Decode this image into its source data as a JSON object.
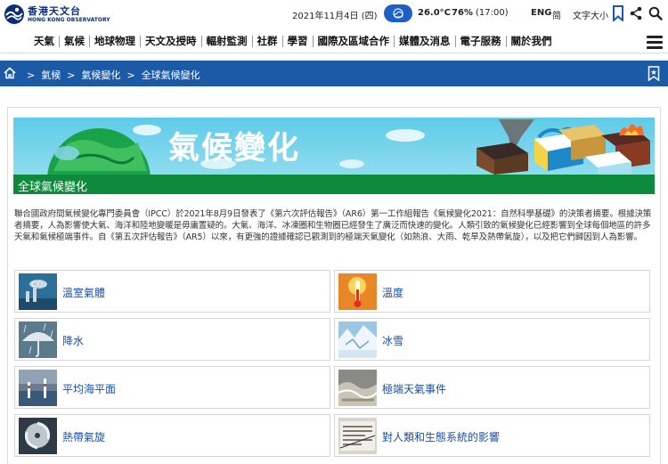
{
  "header": {
    "logo_cn": "香港天文台",
    "logo_en": "HONG KONG OBSERVATORY",
    "date": "2021年11月4日 (四)",
    "temperature": "26.0°C",
    "humidity": "76%",
    "time": "(17:00)",
    "lang_en": "ENG",
    "lang_sc": "简",
    "font_size": "文字大小"
  },
  "nav": {
    "items": [
      "天氣",
      "氣候",
      "地球物理",
      "天文及授時",
      "輻射監測",
      "社群",
      "學習",
      "國際及區域合作",
      "媒體及消息",
      "電子服務",
      "關於我們"
    ]
  },
  "breadcrumb": {
    "items": [
      "氣候",
      "氣候變化",
      "全球氣候變化"
    ]
  },
  "banner": {
    "title": "氣候變化",
    "subtitle": "全球氣候變化"
  },
  "intro": "聯合國政府間氣候變化專門委員會（IPCC）於2021年8月9日發表了《第六次評估報告》（AR6）第一工作組報告《氣候變化2021：自然科學基礎》的決策者摘要。根據決策者摘要，人為影響使大氣、海洋和陸地變暖是毋庸置疑的。大氣、海洋、冰凍圈和生物圈已經發生了廣泛而快速的變化。人類引致的氣候變化已經影響到全球每個地區的許多天氣和氣候極端事件。自《第五次評估報告》（AR5）以來，有更強的證據確認已觀測到的極端天氣變化（如熱浪、大雨、乾旱及熱帶氣旋），以及把它們歸因到人為影響。",
  "tiles": [
    {
      "label": "溫室氣體",
      "icon": "greenhouse-gas-thumb"
    },
    {
      "label": "溫度",
      "icon": "temperature-thumb"
    },
    {
      "label": "降水",
      "icon": "precipitation-thumb"
    },
    {
      "label": "冰雪",
      "icon": "ice-snow-thumb"
    },
    {
      "label": "平均海平面",
      "icon": "sea-level-thumb"
    },
    {
      "label": "極端天氣事件",
      "icon": "extreme-weather-thumb"
    },
    {
      "label": "熱帶氣旋",
      "icon": "tropical-cyclone-thumb"
    },
    {
      "label": "對人類和生態系統的影響",
      "icon": "impact-thumb"
    }
  ],
  "colors": {
    "brand_blue": "#1c5aa6",
    "green_bar": "#0d8a3c",
    "link_blue": "#1a4fa0",
    "banner_sky": "#5fcbe8"
  }
}
